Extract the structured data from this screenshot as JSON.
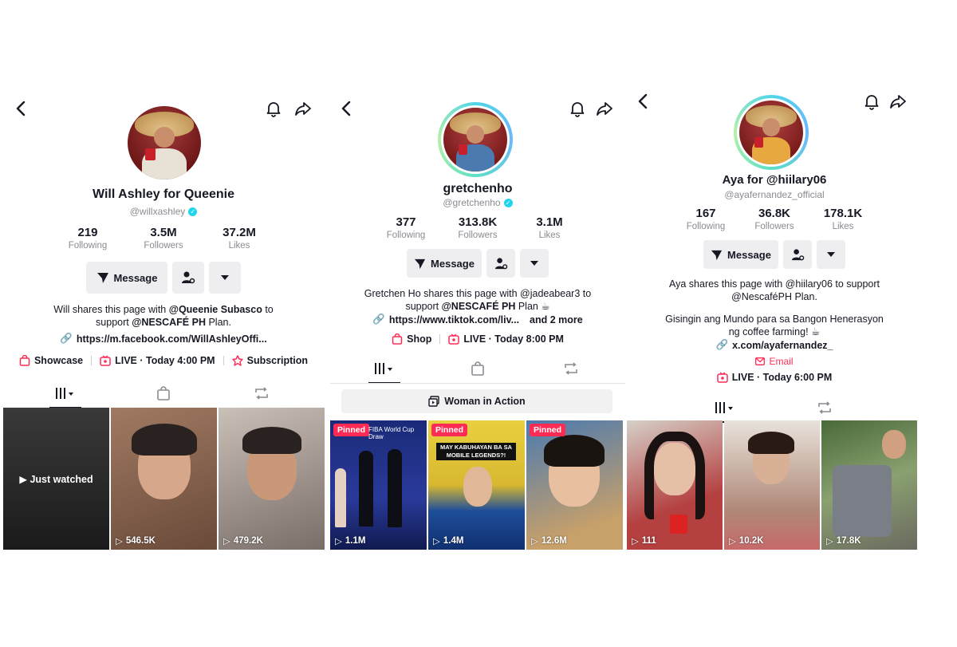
{
  "profiles": [
    {
      "display_name": "Will Ashley for Queenie",
      "handle": "@willxashley",
      "stats": [
        {
          "value": "219",
          "label": "Following"
        },
        {
          "value": "3.5M",
          "label": "Followers"
        },
        {
          "value": "37.2M",
          "label": "Likes"
        }
      ],
      "message_label": "Message",
      "bio_line1_pre": "Will shares this page with ",
      "bio_line1_bold": "@Queenie Subasco",
      "bio_line1_post": " to",
      "bio_line2_pre": "support ",
      "bio_line2_bold": "@NESCAFÉ PH",
      "bio_line2_post": " Plan.",
      "link": "https://m.facebook.com/WillAshleyOffi...",
      "meta": [
        {
          "icon": "bag-icon",
          "label": "Showcase"
        },
        {
          "icon": "live-icon",
          "label": "LIVE · Today 4:00 PM"
        },
        {
          "icon": "subscription-icon",
          "label": "Subscription"
        }
      ],
      "videos": [
        {
          "overlay": "Just watched",
          "views": "",
          "bg": "#2a2a2a"
        },
        {
          "views": "546.5K",
          "bg": "#8a6a5a"
        },
        {
          "views": "479.2K",
          "bg": "#9a8a80"
        }
      ]
    },
    {
      "display_name": "gretchenho",
      "handle": "@gretchenho",
      "stats": [
        {
          "value": "377",
          "label": "Following"
        },
        {
          "value": "313.8K",
          "label": "Followers"
        },
        {
          "value": "3.1M",
          "label": "Likes"
        }
      ],
      "message_label": "Message",
      "bio_line1": "Gretchen Ho shares this page with @jadeabear3 to",
      "bio_line2_pre": "support ",
      "bio_line2_bold": "@NESCAFÉ PH",
      "bio_line2_post": " Plan ☕",
      "link": "https://www.tiktok.com/liv...",
      "link_more": "and 2 more",
      "meta": [
        {
          "icon": "bag-icon",
          "label": "Shop"
        },
        {
          "icon": "live-icon",
          "label": "LIVE · Today 8:00 PM"
        }
      ],
      "playlist_label": "Woman in Action",
      "videos": [
        {
          "pinned": "Pinned",
          "caption": "FIBA World Cup Draw",
          "views": "1.1M",
          "bg": "#1c2a6b"
        },
        {
          "pinned": "Pinned",
          "caption": "MAY KABUHAYAN BA SA MOBILE LEGENDS?!",
          "views": "1.4M",
          "bg": "#e0c640"
        },
        {
          "pinned": "Pinned",
          "views": "12.6M",
          "bg": "#3a6a9a"
        }
      ]
    },
    {
      "display_name": "Aya for @hiilary06",
      "handle": "@ayafernandez_official",
      "stats": [
        {
          "value": "167",
          "label": "Following"
        },
        {
          "value": "36.8K",
          "label": "Followers"
        },
        {
          "value": "178.1K",
          "label": "Likes"
        }
      ],
      "message_label": "Message",
      "bio_line1": "Aya shares this page with @hiilary06 to support",
      "bio_line2": "@NescaféPH Plan.",
      "bio_line3": "Gisingin ang Mundo para sa Bangon Henerasyon",
      "bio_line4": "ng coffee farming! ☕",
      "link": "x.com/ayafernandez_",
      "email_label": "Email",
      "meta": [
        {
          "icon": "live-icon",
          "label": "LIVE · Today 6:00 PM"
        }
      ],
      "videos": [
        {
          "views": "111",
          "bg": "#b83a3a"
        },
        {
          "views": "10.2K",
          "bg": "#a88878"
        },
        {
          "views": "17.8K",
          "bg": "#5a7a4a"
        }
      ]
    }
  ]
}
